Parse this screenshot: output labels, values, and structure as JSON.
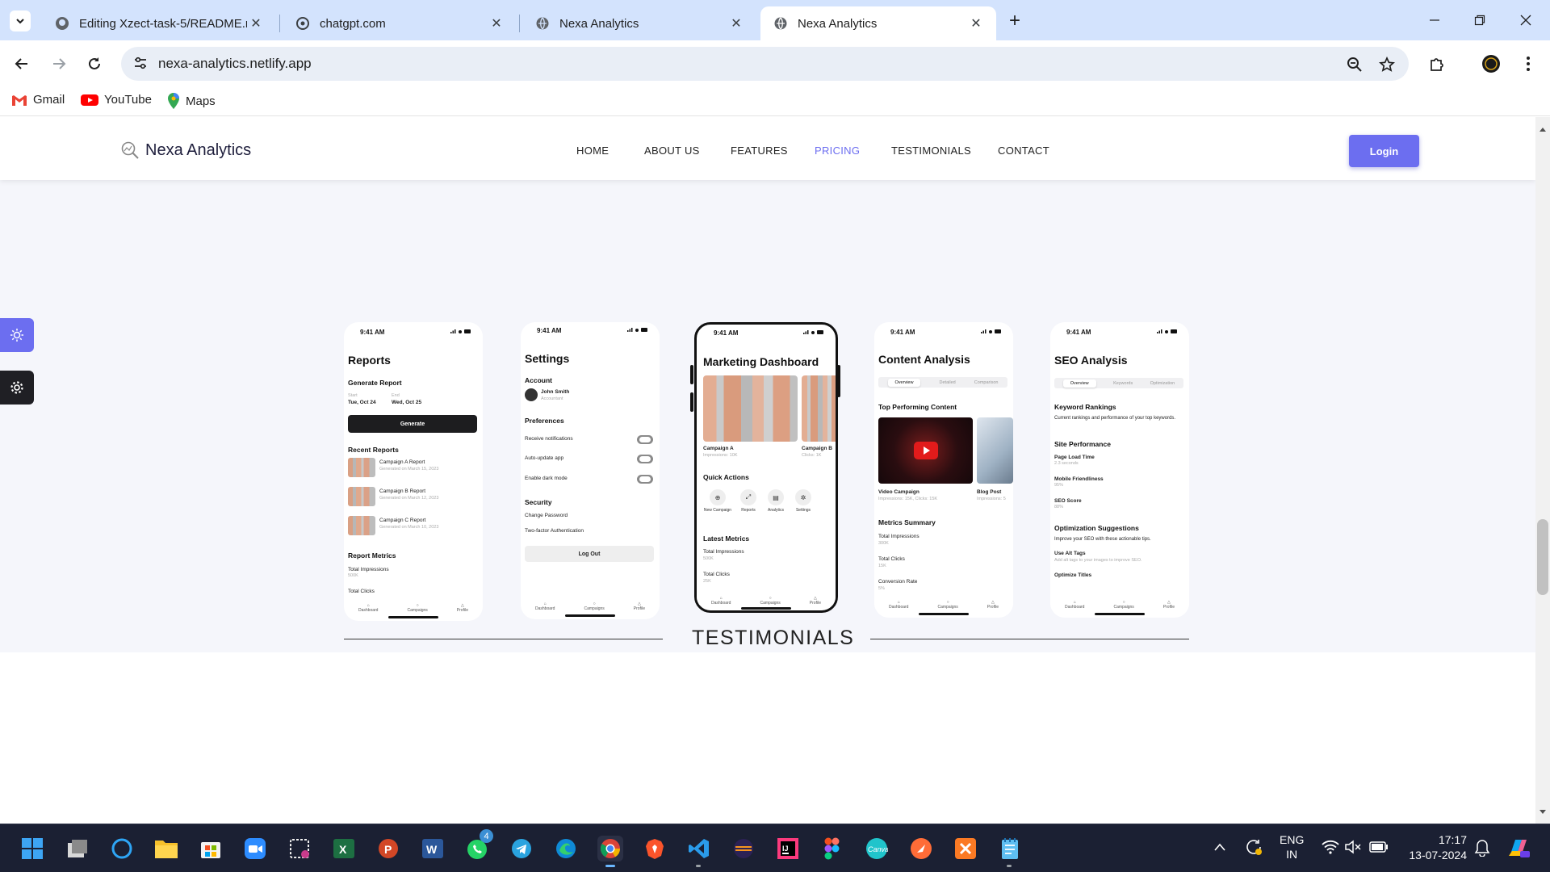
{
  "browser": {
    "tabs": [
      {
        "title": "Editing Xzect-task-5/README.m",
        "icon": "github-icon",
        "active": false
      },
      {
        "title": "chatgpt.com",
        "icon": "chatgpt-icon",
        "active": false
      },
      {
        "title": "Nexa Analytics",
        "icon": "globe-icon",
        "active": false
      },
      {
        "title": "Nexa Analytics",
        "icon": "globe-icon",
        "active": true
      }
    ],
    "url": "nexa-analytics.netlify.app",
    "bookmarks": [
      {
        "label": "Gmail",
        "icon": "gmail-icon"
      },
      {
        "label": "YouTube",
        "icon": "youtube-icon"
      },
      {
        "label": "Maps",
        "icon": "maps-icon"
      }
    ]
  },
  "site": {
    "brand": "Nexa Analytics",
    "nav": [
      "HOME",
      "ABOUT US",
      "FEATURES",
      "PRICING",
      "TESTIMONIALS",
      "CONTACT"
    ],
    "active_nav": "PRICING",
    "login_label": "Login",
    "accent": "#6c6ef0",
    "section_title": "TESTIMONIALS"
  },
  "phones": {
    "time": "9:41 AM",
    "bottom_nav": [
      "Dashboard",
      "Campaigns",
      "Profile"
    ],
    "reports": {
      "title": "Reports",
      "generate_heading": "Generate Report",
      "start_label": "Start",
      "end_label": "End",
      "start_date": "Tue, Oct 24",
      "end_date": "Wed, Oct 25",
      "generate_button": "Generate",
      "recent_heading": "Recent Reports",
      "recent": [
        {
          "name": "Campaign A Report",
          "meta": "Generated on March 15, 2023"
        },
        {
          "name": "Campaign B Report",
          "meta": "Generated on March 12, 2023"
        },
        {
          "name": "Campaign C Report",
          "meta": "Generated on March 10, 2023"
        }
      ],
      "metrics_heading": "Report Metrics",
      "metric1": "Total Impressions",
      "metric1_value": "500K",
      "metric2": "Total Clicks"
    },
    "settings": {
      "title": "Settings",
      "account_heading": "Account",
      "user_name": "John Smith",
      "user_role": "Accountant",
      "preferences_heading": "Preferences",
      "prefs": [
        "Receive notifications",
        "Auto-update app",
        "Enable dark mode"
      ],
      "security_heading": "Security",
      "security_items": [
        "Change Password",
        "Two-factor Authentication"
      ],
      "logout": "Log Out"
    },
    "marketing": {
      "title": "Marketing Dashboard",
      "campaign_a": "Campaign A",
      "campaign_a_meta": "Impressions: 10K",
      "campaign_b": "Campaign B",
      "campaign_b_meta": "Clicks: 1K",
      "quick_actions_heading": "Quick Actions",
      "actions": [
        "New Campaign",
        "Reports",
        "Analytics",
        "Settings"
      ],
      "latest_heading": "Latest Metrics",
      "m1": "Total Impressions",
      "m1_value": "500K",
      "m2": "Total Clicks",
      "m2_value": "25K"
    },
    "content": {
      "title": "Content Analysis",
      "tabs": [
        "Overview",
        "Detailed",
        "Comparison"
      ],
      "top_heading": "Top Performing Content",
      "item1": "Video Campaign",
      "item1_meta": "Impressions: 15K, Clicks: 15K",
      "item2": "Blog Post",
      "item2_meta": "Impressions: 5",
      "summary_heading": "Metrics Summary",
      "s1": "Total Impressions",
      "s1_value": "300K",
      "s2": "Total Clicks",
      "s2_value": "15K",
      "s3": "Conversion Rate",
      "s3_value": "5%"
    },
    "seo": {
      "title": "SEO Analysis",
      "tabs": [
        "Overview",
        "Keywords",
        "Optimization"
      ],
      "kw_heading": "Keyword Rankings",
      "kw_text": "Current rankings and performance of your top keywords.",
      "site_heading": "Site Performance",
      "p1": "Page Load Time",
      "p1_value": "2.3 seconds",
      "p2": "Mobile Friendliness",
      "p2_value": "95%",
      "p3": "SEO Score",
      "p3_value": "88%",
      "opt_heading": "Optimization Suggestions",
      "opt_text": "Improve your SEO with these actionable tips.",
      "o1": "Use Alt Tags",
      "o1_text": "Add alt tags to your images to improve SEO.",
      "o2": "Optimize Titles"
    }
  },
  "taskbar": {
    "apps": [
      "windows-start-icon",
      "task-view-icon",
      "cortana-icon",
      "file-explorer-icon",
      "microsoft-store-icon",
      "zoom-icon",
      "snipping-tool-icon",
      "excel-icon",
      "powerpoint-icon",
      "word-icon",
      "whatsapp-icon",
      "telegram-icon",
      "edge-icon",
      "chrome-icon",
      "brave-icon",
      "vscode-icon",
      "eclipse-icon",
      "intellij-icon",
      "figma-icon",
      "canva-icon",
      "postman-icon",
      "xampp-icon",
      "notepad-icon"
    ],
    "whatsapp_badge": "4",
    "lang_top": "ENG",
    "lang_bottom": "IN",
    "time": "17:17",
    "date": "13-07-2024"
  }
}
